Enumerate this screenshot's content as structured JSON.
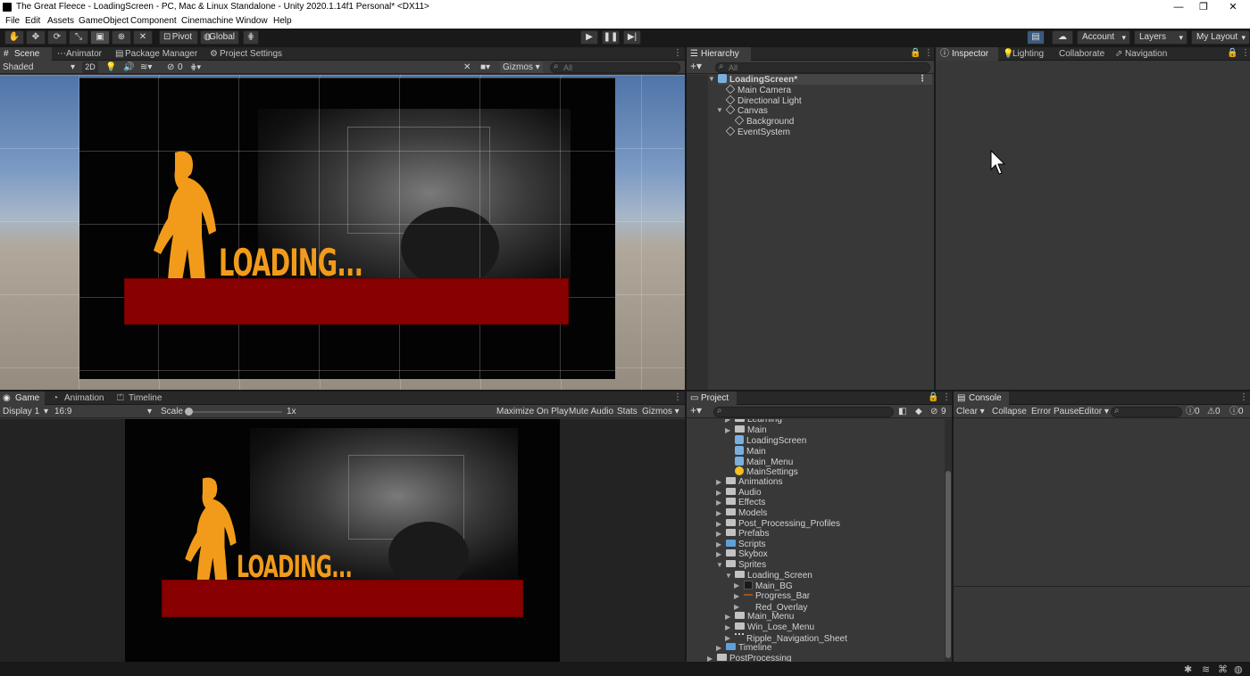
{
  "window": {
    "title": "The Great Fleece - LoadingScreen - PC, Mac & Linux Standalone - Unity 2020.1.14f1 Personal* <DX11>",
    "minimize": "—",
    "restore": "❐",
    "close": "✕"
  },
  "menu": [
    "File",
    "Edit",
    "Assets",
    "GameObject",
    "Component",
    "Cinemachine",
    "Window",
    "Help"
  ],
  "toolbar": {
    "pivot": "Pivot",
    "global": "Global",
    "account": "Account",
    "layers": "Layers",
    "layout": "My Layout"
  },
  "scene": {
    "tabs": [
      "Scene",
      "Animator",
      "Package Manager",
      "Project Settings"
    ],
    "shading": "Shaded",
    "mode_2d": "2D",
    "hidden_count": "0",
    "gizmos": "Gizmos",
    "search_placeholder": "All",
    "loading_text": "LOADING..."
  },
  "hierarchy": {
    "tab": "Hierarchy",
    "search_placeholder": "All",
    "scene_name": "LoadingScreen*",
    "items": [
      "Main Camera",
      "Directional Light",
      "Canvas",
      "Background",
      "EventSystem"
    ]
  },
  "inspector": {
    "tabs": [
      "Inspector",
      "Lighting",
      "Collaborate",
      "Navigation"
    ]
  },
  "game": {
    "tabs": [
      "Game",
      "Animation",
      "Timeline"
    ],
    "display": "Display 1",
    "aspect": "16:9",
    "scale_label": "Scale",
    "scale_value": "1x",
    "maximize": "Maximize On Play",
    "mute": "Mute Audio",
    "stats": "Stats",
    "gizmos": "Gizmos",
    "loading_text": "LOADING..."
  },
  "project": {
    "tab": "Project",
    "hidden_count": "9",
    "items": [
      {
        "label": "Learning",
        "indent": 1,
        "type": "folder",
        "arrow": "▶"
      },
      {
        "label": "Main",
        "indent": 1,
        "type": "folder",
        "arrow": "▶"
      },
      {
        "label": "LoadingScreen",
        "indent": 1,
        "type": "scene",
        "arrow": ""
      },
      {
        "label": "Main",
        "indent": 1,
        "type": "scene",
        "arrow": ""
      },
      {
        "label": "Main_Menu",
        "indent": 1,
        "type": "scene",
        "arrow": ""
      },
      {
        "label": "MainSettings",
        "indent": 1,
        "type": "settings",
        "arrow": ""
      },
      {
        "label": "Animations",
        "indent": 0,
        "type": "folder",
        "arrow": "▶"
      },
      {
        "label": "Audio",
        "indent": 0,
        "type": "folder",
        "arrow": "▶"
      },
      {
        "label": "Effects",
        "indent": 0,
        "type": "folder",
        "arrow": "▶"
      },
      {
        "label": "Models",
        "indent": 0,
        "type": "folder",
        "arrow": "▶"
      },
      {
        "label": "Post_Processing_Profiles",
        "indent": 0,
        "type": "folder",
        "arrow": "▶"
      },
      {
        "label": "Prefabs",
        "indent": 0,
        "type": "folder",
        "arrow": "▶"
      },
      {
        "label": "Scripts",
        "indent": 0,
        "type": "folder-blue",
        "arrow": "▶"
      },
      {
        "label": "Skybox",
        "indent": 0,
        "type": "folder",
        "arrow": "▶"
      },
      {
        "label": "Sprites",
        "indent": 0,
        "type": "folder",
        "arrow": "▼"
      },
      {
        "label": "Loading_Screen",
        "indent": 1,
        "type": "folder",
        "arrow": "▼"
      },
      {
        "label": "Main_BG",
        "indent": 2,
        "type": "sprite-dark",
        "arrow": "▶"
      },
      {
        "label": "Progress_Bar",
        "indent": 2,
        "type": "sprite-bar",
        "arrow": "▶"
      },
      {
        "label": "Red_Overlay",
        "indent": 2,
        "type": "sprite-none",
        "arrow": "▶"
      },
      {
        "label": "Main_Menu",
        "indent": 1,
        "type": "folder",
        "arrow": "▶"
      },
      {
        "label": "Win_Lose_Menu",
        "indent": 1,
        "type": "folder",
        "arrow": "▶"
      },
      {
        "label": "Ripple_Navigation_Sheet",
        "indent": 1,
        "type": "sprite-sheet",
        "arrow": "▶"
      },
      {
        "label": "Timeline",
        "indent": 0,
        "type": "folder-blue",
        "arrow": "▶"
      },
      {
        "label": "PostProcessing",
        "indent": -1,
        "type": "folder",
        "arrow": "▶"
      }
    ]
  },
  "console": {
    "tab": "Console",
    "clear": "Clear",
    "collapse": "Collapse",
    "error_pause": "Error Pause",
    "editor": "Editor",
    "count_log": "0",
    "count_warn": "0",
    "count_err": "0"
  }
}
